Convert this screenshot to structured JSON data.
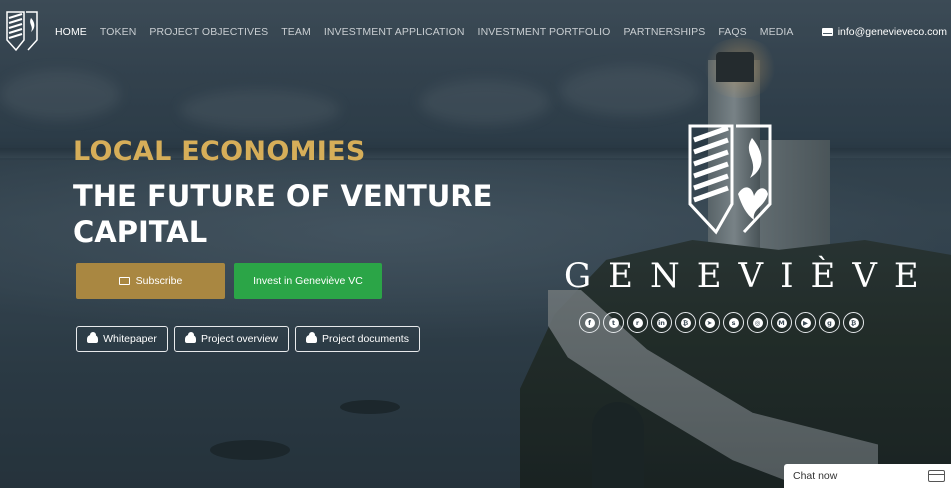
{
  "nav": {
    "items": [
      {
        "label": "HOME",
        "active": true
      },
      {
        "label": "TOKEN",
        "active": false
      },
      {
        "label": "PROJECT OBJECTIVES",
        "active": false
      },
      {
        "label": "TEAM",
        "active": false
      },
      {
        "label": "INVESTMENT APPLICATION",
        "active": false
      },
      {
        "label": "INVESTMENT PORTFOLIO",
        "active": false
      },
      {
        "label": "PARTNERSHIPS",
        "active": false
      },
      {
        "label": "FAQS",
        "active": false
      },
      {
        "label": "MEDIA",
        "active": false
      }
    ],
    "email": "info@genevieveco.com"
  },
  "hero": {
    "headline_small": "LOCAL ECONOMIES",
    "headline_big": "THE FUTURE OF VENTURE CAPITAL",
    "buttons": {
      "subscribe": "Subscribe",
      "invest": "Invest in Geneviève VC",
      "whitepaper": "Whitepaper",
      "project_overview": "Project overview",
      "project_documents": "Project documents"
    }
  },
  "brand": {
    "name": "GENEVIÈVE",
    "socials": [
      {
        "icon": "facebook-icon",
        "glyph": "f"
      },
      {
        "icon": "twitter-icon",
        "glyph": "t"
      },
      {
        "icon": "reddit-icon",
        "glyph": "r"
      },
      {
        "icon": "linkedin-icon",
        "glyph": "in"
      },
      {
        "icon": "bitcoin-icon",
        "glyph": "₿"
      },
      {
        "icon": "telegram-icon",
        "glyph": "➤"
      },
      {
        "icon": "snapchat-icon",
        "glyph": "s"
      },
      {
        "icon": "instagram-icon",
        "glyph": "◎"
      },
      {
        "icon": "medium-icon",
        "glyph": "M"
      },
      {
        "icon": "youtube-icon",
        "glyph": "▶"
      },
      {
        "icon": "github-icon",
        "glyph": "g"
      },
      {
        "icon": "bitcoin-alt-icon",
        "glyph": "₿"
      }
    ]
  },
  "chat": {
    "label": "Chat now"
  },
  "colors": {
    "gold": "#d6ae59",
    "subscribe_bg": "#a98741",
    "invest_bg": "#2ba547"
  }
}
